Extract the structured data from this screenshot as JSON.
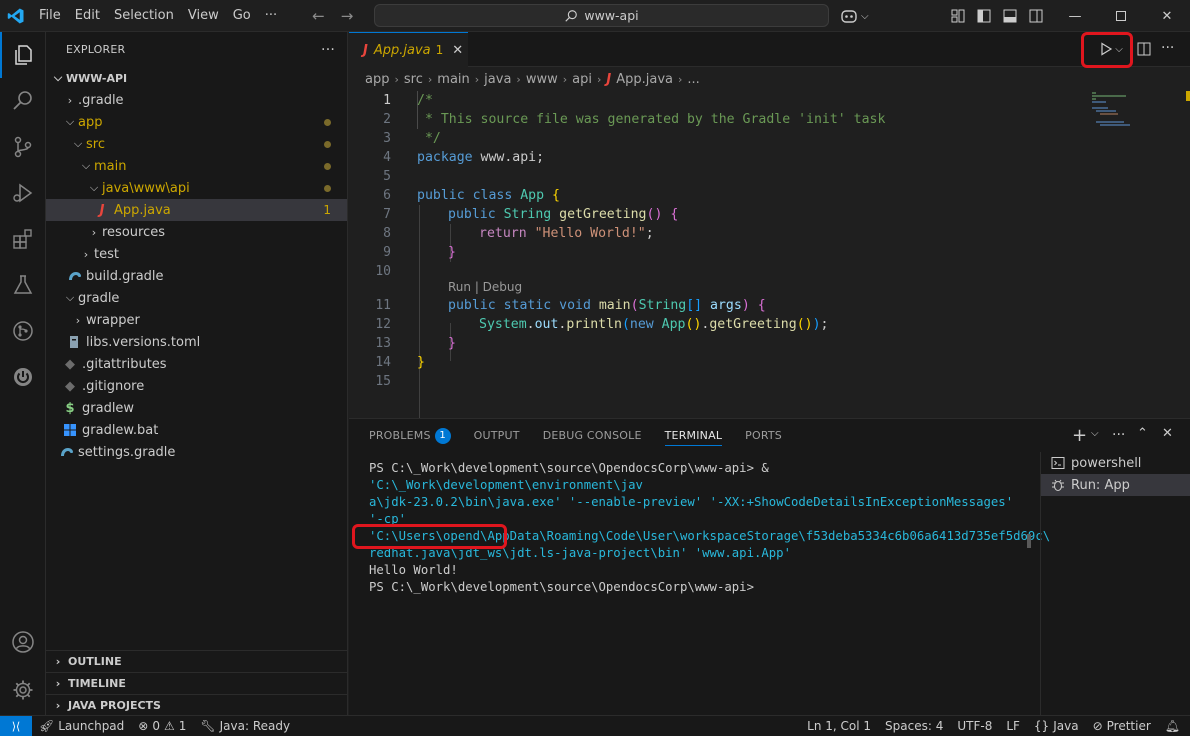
{
  "titlebar": {
    "menus": [
      "File",
      "Edit",
      "Selection",
      "View",
      "Go",
      "···"
    ],
    "search": "www-api"
  },
  "explorer": {
    "title": "EXPLORER",
    "root": "WWW-API",
    "items": [
      {
        "label": ".gradle"
      },
      {
        "label": "app"
      },
      {
        "label": "src"
      },
      {
        "label": "main"
      },
      {
        "label": "java\\www\\api"
      },
      {
        "label": "App.java",
        "count": "1"
      },
      {
        "label": "resources"
      },
      {
        "label": "test"
      },
      {
        "label": "build.gradle"
      },
      {
        "label": "gradle"
      },
      {
        "label": "wrapper"
      },
      {
        "label": "libs.versions.toml"
      },
      {
        "label": ".gitattributes"
      },
      {
        "label": ".gitignore"
      },
      {
        "label": "gradlew"
      },
      {
        "label": "gradlew.bat"
      },
      {
        "label": "settings.gradle"
      }
    ],
    "sections": [
      "OUTLINE",
      "TIMELINE",
      "JAVA PROJECTS"
    ]
  },
  "editor": {
    "tab": {
      "label": "App.java",
      "count": "1"
    },
    "breadcrumbs": [
      "app",
      "src",
      "main",
      "java",
      "www",
      "api",
      "App.java",
      "..."
    ],
    "codelens": "Run | Debug",
    "line_numbers": [
      "1",
      "2",
      "3",
      "4",
      "5",
      "6",
      "7",
      "8",
      "9",
      "10",
      "11",
      "12",
      "13",
      "14",
      "15"
    ],
    "code": {
      "l1": "/*",
      "l2": " * This source file was generated by the Gradle 'init' task",
      "l3": " */",
      "l4a": "package",
      "l4b": " www.api;",
      "l6a": "public",
      "l6b": " class",
      "l6c": " App",
      "l6d": " {",
      "l7a": "public",
      "l7b": " String",
      "l7c": " getGreeting",
      "l7d": "()",
      "l7e": " {",
      "l8a": "return",
      "l8b": " \"Hello World!\"",
      "l8c": ";",
      "l9": "}",
      "l11a": "public",
      "l11b": " static",
      "l11c": " void",
      "l11d": " main",
      "l11e": "(",
      "l11f": "String",
      "l11g": "[]",
      "l11h": " args",
      "l11i": ")",
      "l11j": " {",
      "l12a": "System",
      "l12b": ".",
      "l12c": "out",
      "l12d": ".",
      "l12e": "println",
      "l12f": "(",
      "l12g": "new",
      "l12h": " App",
      "l12i": "()",
      "l12j": ".",
      "l12k": "getGreeting",
      "l12l": "()",
      "l12m": ")",
      "l12n": ";",
      "l13": "}",
      "l14": "}"
    }
  },
  "panel": {
    "tabs": [
      "PROBLEMS",
      "OUTPUT",
      "DEBUG CONSOLE",
      "TERMINAL",
      "PORTS"
    ],
    "problems_count": "1",
    "terminal": {
      "prompt1": "PS C:\\_Work\\development\\source\\OpendocsCorp\\www-api>",
      "amp": "  &",
      "cmd1": " 'C:\\_Work\\development\\environment\\jav",
      "cmd2": "a\\jdk-23.0.2\\bin\\java.exe'",
      "cmd2b": " '--enable-preview' '-XX:+ShowCodeDetailsInExceptionMessages' '-cp'",
      "cmd3": " 'C:\\Users\\opend\\AppData\\Roaming\\Code\\User\\workspaceStorage\\f53deba5334c6b06a6413d735ef5d69c\\",
      "cmd4": "redhat.java\\jdt_ws\\jdt.ls-java-project\\bin' 'www.api.App'",
      "output": "Hello World!",
      "prompt2": "PS C:\\_Work\\development\\source\\OpendocsCorp\\www-api>"
    },
    "terminals": [
      "powershell",
      "Run: App"
    ]
  },
  "statusbar": {
    "launchpad": "Launchpad",
    "errors": "0",
    "warnings": "1",
    "java": "Java: Ready",
    "position": "Ln 1, Col 1",
    "spaces": "Spaces: 4",
    "encoding": "UTF-8",
    "eol": "LF",
    "language": "Java",
    "prettier": "Prettier"
  },
  "colors": {
    "accent": "#0078d4",
    "highlight": "#e0161e",
    "modified": "#cca700"
  }
}
